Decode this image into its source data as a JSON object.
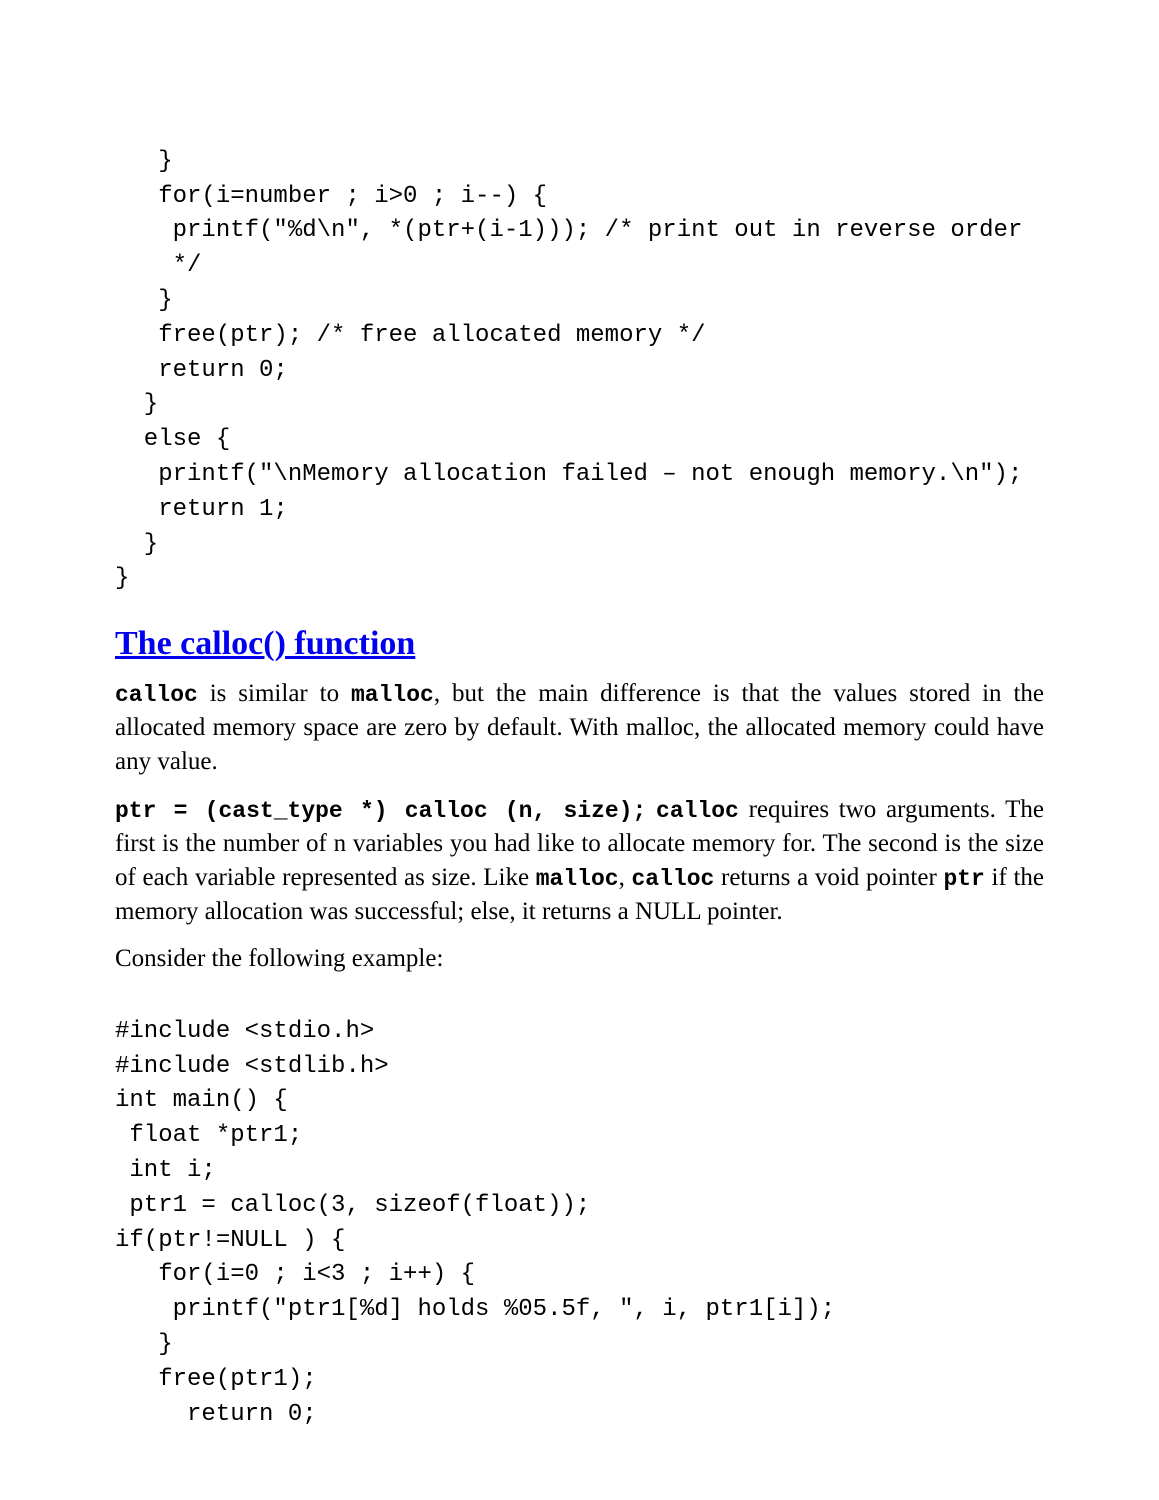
{
  "code_block_1": {
    "l0": "   }",
    "l1": "   for(i=number ; i>0 ; i--) {",
    "l2": "    printf(\"%d\\n\", *(ptr+(i-1))); /* print out in reverse order",
    "l3": "    */",
    "l4": "   }",
    "l5": "   free(ptr); /* free allocated memory */",
    "l6": "   return 0;",
    "l7": "  }",
    "l8": "  else {",
    "l9": "   printf(\"\\nMemory allocation failed – not enough memory.\\n\");",
    "l10": "   return 1;",
    "l11": "  }",
    "l12": "}"
  },
  "heading": "The calloc() function",
  "para1": {
    "calloc": "calloc",
    "t1": " is similar to ",
    "malloc": "malloc",
    "t2": ", but the main difference is that the values stored in the allocated memory space are zero by default. With malloc, the allocated memory could have any value."
  },
  "para2": {
    "sig": "ptr = (cast_type *) calloc (n, size);",
    "calloc2": "calloc",
    "t1": " requires two arguments. The first is the number of n variables you had like to allocate memory for. The second is the size of each variable represented as size. Like ",
    "malloc2": "malloc",
    "t2": ", ",
    "calloc3": "calloc",
    "t3": " returns a void pointer ",
    "ptr": "ptr",
    "t4": " if the memory allocation was successful; else, it returns a NULL pointer."
  },
  "para3": "Consider the following example:",
  "code_block_2": {
    "l0": "#include <stdio.h>",
    "l1": "#include <stdlib.h>",
    "l2": "int main() {",
    "l3": " float *ptr1;",
    "l4": " int i;",
    "l5": " ptr1 = calloc(3, sizeof(float));",
    "l6": "if(ptr!=NULL ) {",
    "l7": "   for(i=0 ; i<3 ; i++) {",
    "l8": "    printf(\"ptr1[%d] holds %05.5f, \", i, ptr1[i]);",
    "l9": "   }",
    "l10": "   free(ptr1);",
    "l11": "     return 0;"
  }
}
